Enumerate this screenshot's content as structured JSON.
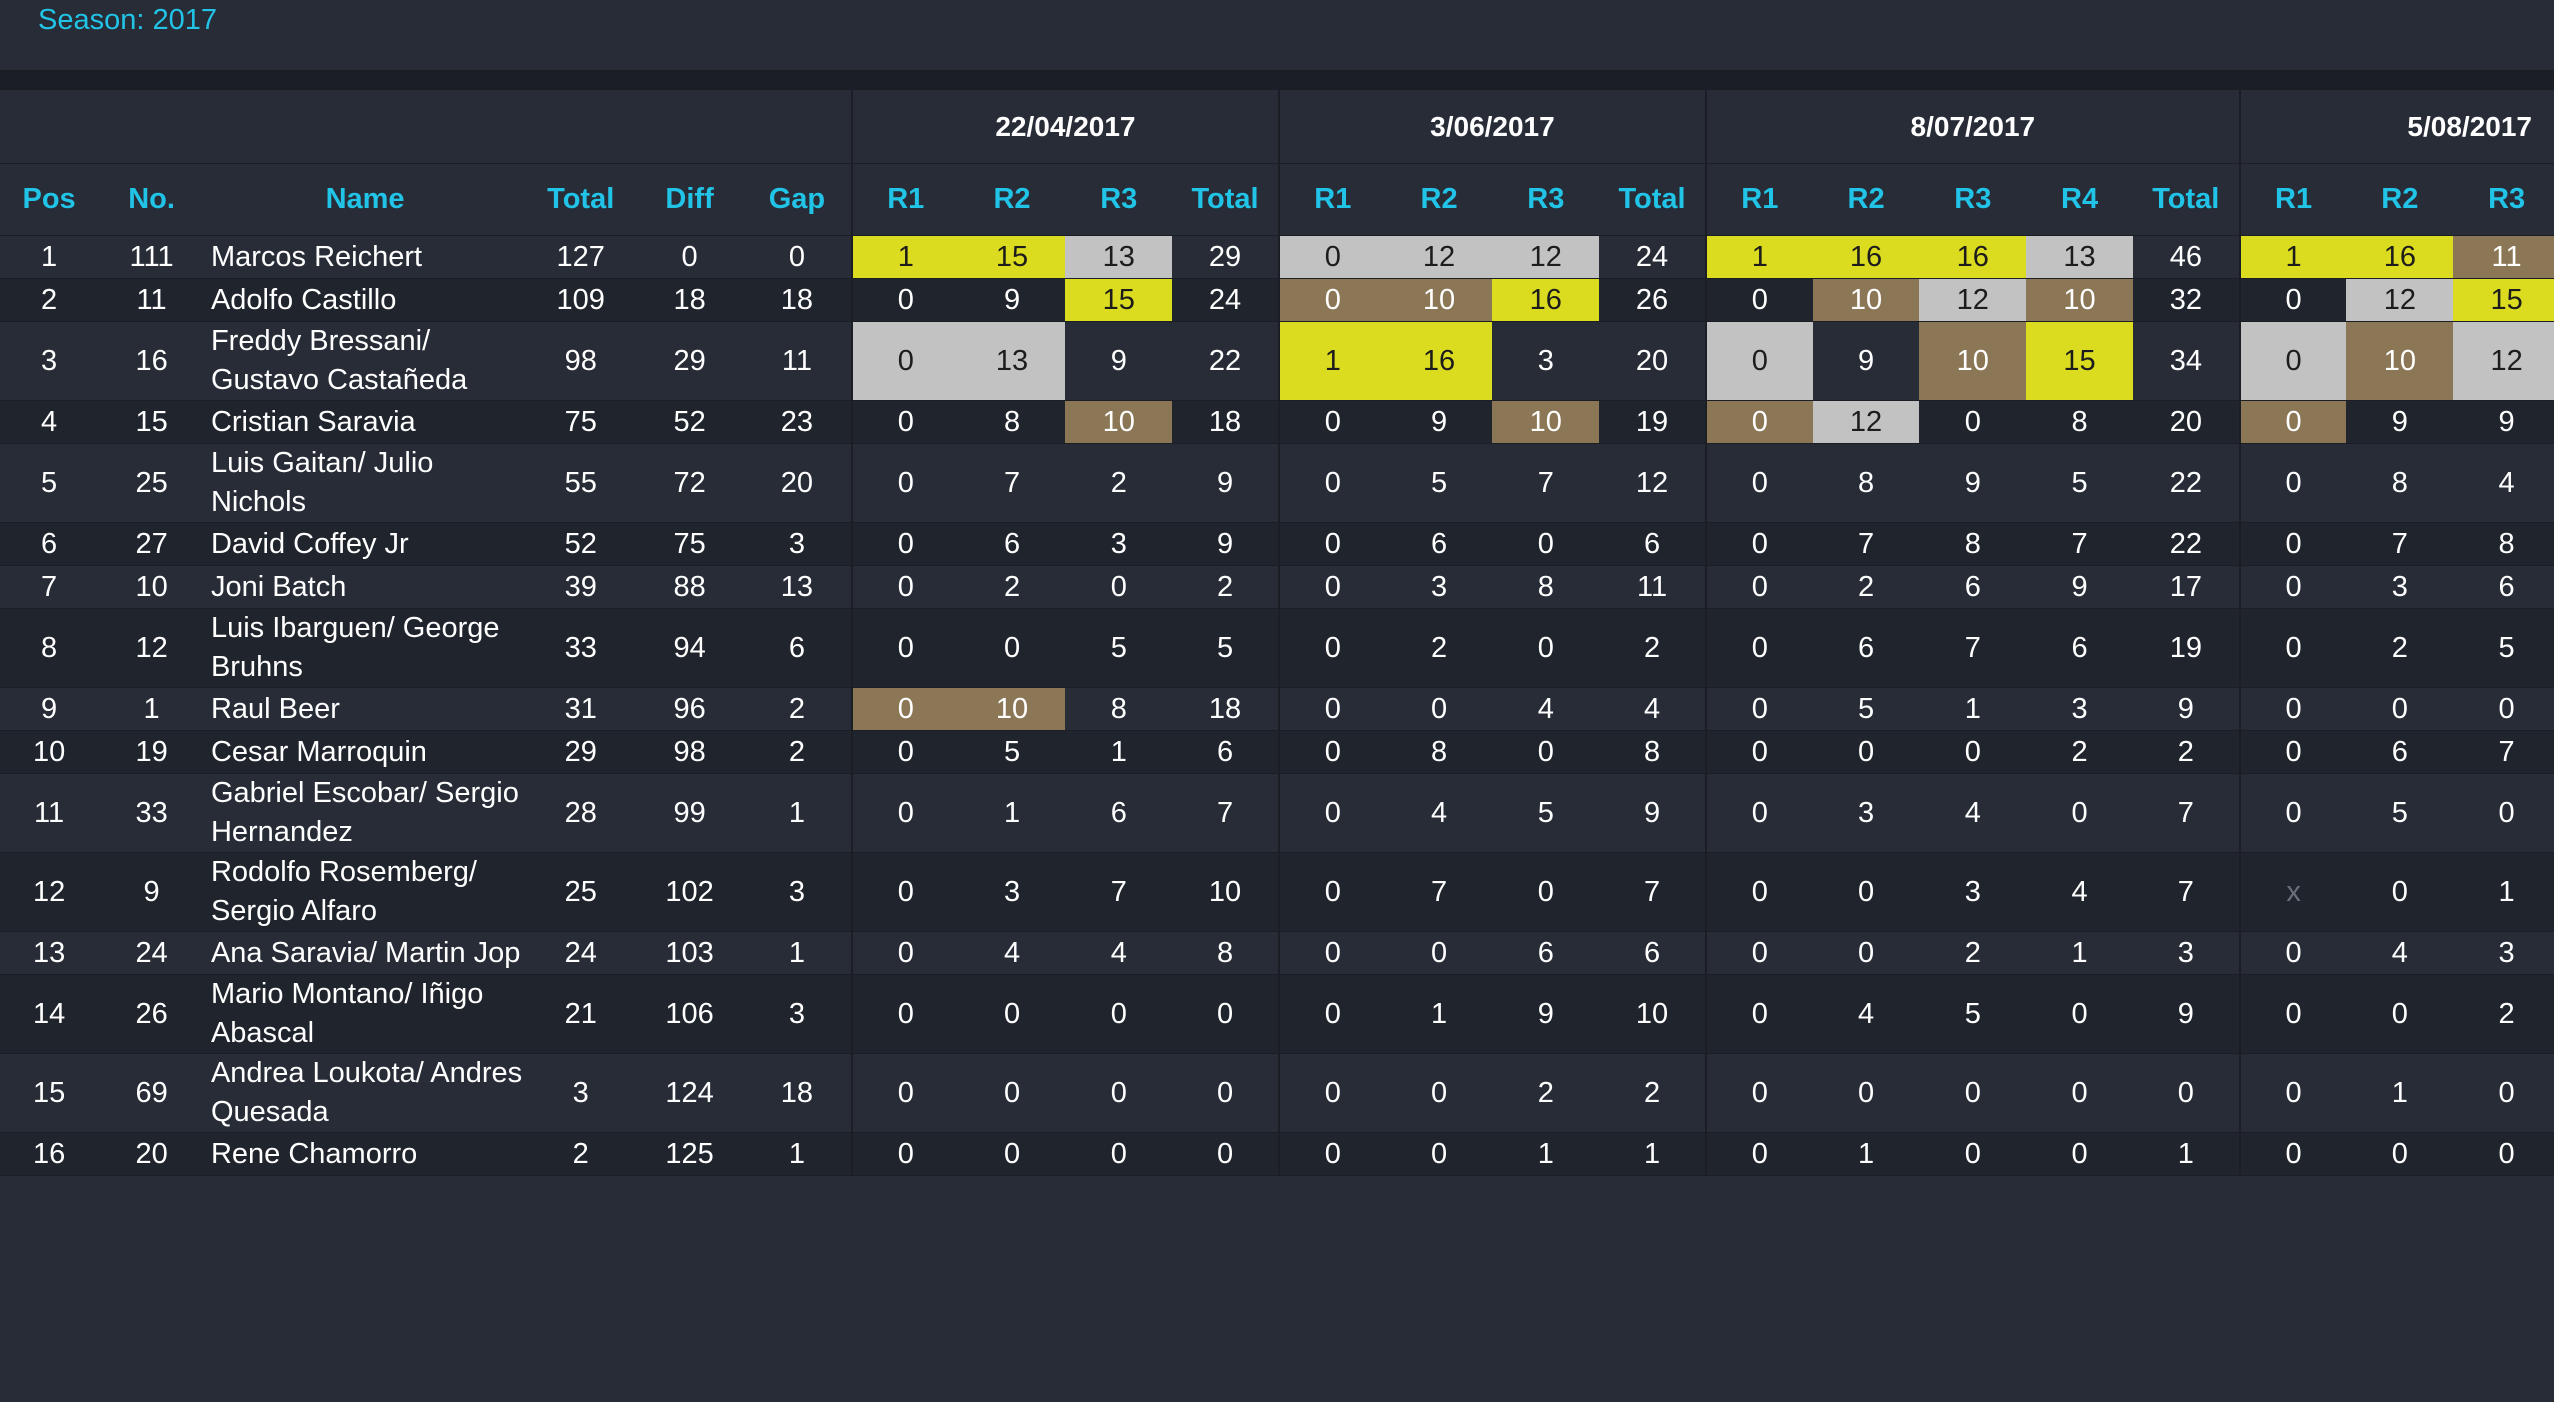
{
  "season_label": "Season: 2017",
  "events": [
    {
      "date": "22/04/2017",
      "races": [
        "R1",
        "R2",
        "R3"
      ]
    },
    {
      "date": "3/06/2017",
      "races": [
        "R1",
        "R2",
        "R3"
      ]
    },
    {
      "date": "8/07/2017",
      "races": [
        "R1",
        "R2",
        "R3",
        "R4"
      ]
    },
    {
      "date": "5/08/2017",
      "races": [
        "R1",
        "R2",
        "R3"
      ]
    }
  ],
  "headers": {
    "pos": "Pos",
    "no": "No.",
    "name": "Name",
    "total": "Total",
    "diff": "Diff",
    "gap": "Gap",
    "event_total": "Total"
  },
  "colors": {
    "gold": "#dbdb1f",
    "silver": "#c2c2c2",
    "bronze": "#8b7655",
    "accent": "#21c4e6"
  },
  "rows": [
    {
      "pos": "1",
      "no": "111",
      "name": "Marcos Reichert",
      "total": "127",
      "diff": "0",
      "gap": "0",
      "events": [
        {
          "r": [
            "1",
            "15",
            "13"
          ],
          "m": [
            "g",
            "g",
            "s"
          ],
          "t": "29"
        },
        {
          "r": [
            "0",
            "12",
            "12"
          ],
          "m": [
            "s",
            "s",
            "s"
          ],
          "t": "24"
        },
        {
          "r": [
            "1",
            "16",
            "16",
            "13"
          ],
          "m": [
            "g",
            "g",
            "g",
            "s"
          ],
          "t": "46"
        },
        {
          "r": [
            "1",
            "16",
            "11"
          ],
          "m": [
            "g",
            "g",
            "b"
          ]
        }
      ]
    },
    {
      "pos": "2",
      "no": "11",
      "name": "Adolfo Castillo",
      "total": "109",
      "diff": "18",
      "gap": "18",
      "events": [
        {
          "r": [
            "0",
            "9",
            "15"
          ],
          "m": [
            "",
            "",
            "g"
          ],
          "t": "24"
        },
        {
          "r": [
            "0",
            "10",
            "16"
          ],
          "m": [
            "b",
            "b",
            "g"
          ],
          "t": "26"
        },
        {
          "r": [
            "0",
            "10",
            "12",
            "10"
          ],
          "m": [
            "",
            "b",
            "s",
            "b"
          ],
          "t": "32"
        },
        {
          "r": [
            "0",
            "12",
            "15"
          ],
          "m": [
            "",
            "s",
            "g"
          ]
        }
      ]
    },
    {
      "pos": "3",
      "no": "16",
      "name": "Freddy Bressani/ Gustavo Castañeda",
      "total": "98",
      "diff": "29",
      "gap": "11",
      "events": [
        {
          "r": [
            "0",
            "13",
            "9"
          ],
          "m": [
            "s",
            "s",
            ""
          ],
          "t": "22"
        },
        {
          "r": [
            "1",
            "16",
            "3"
          ],
          "m": [
            "g",
            "g",
            ""
          ],
          "t": "20"
        },
        {
          "r": [
            "0",
            "9",
            "10",
            "15"
          ],
          "m": [
            "s",
            "",
            "b",
            "g"
          ],
          "t": "34"
        },
        {
          "r": [
            "0",
            "10",
            "12"
          ],
          "m": [
            "s",
            "b",
            "s"
          ]
        }
      ]
    },
    {
      "pos": "4",
      "no": "15",
      "name": "Cristian Saravia",
      "total": "75",
      "diff": "52",
      "gap": "23",
      "events": [
        {
          "r": [
            "0",
            "8",
            "10"
          ],
          "m": [
            "",
            "",
            "b"
          ],
          "t": "18"
        },
        {
          "r": [
            "0",
            "9",
            "10"
          ],
          "m": [
            "",
            "",
            "b"
          ],
          "t": "19"
        },
        {
          "r": [
            "0",
            "12",
            "0",
            "8"
          ],
          "m": [
            "b",
            "s",
            "",
            ""
          ],
          "t": "20"
        },
        {
          "r": [
            "0",
            "9",
            "9"
          ],
          "m": [
            "b",
            "",
            ""
          ]
        }
      ]
    },
    {
      "pos": "5",
      "no": "25",
      "name": "Luis Gaitan/ Julio Nichols",
      "total": "55",
      "diff": "72",
      "gap": "20",
      "events": [
        {
          "r": [
            "0",
            "7",
            "2"
          ],
          "m": [
            "",
            "",
            ""
          ],
          "t": "9"
        },
        {
          "r": [
            "0",
            "5",
            "7"
          ],
          "m": [
            "",
            "",
            ""
          ],
          "t": "12"
        },
        {
          "r": [
            "0",
            "8",
            "9",
            "5"
          ],
          "m": [
            "",
            "",
            "",
            ""
          ],
          "t": "22"
        },
        {
          "r": [
            "0",
            "8",
            "4"
          ],
          "m": [
            "",
            "",
            ""
          ]
        }
      ]
    },
    {
      "pos": "6",
      "no": "27",
      "name": "David Coffey Jr",
      "total": "52",
      "diff": "75",
      "gap": "3",
      "events": [
        {
          "r": [
            "0",
            "6",
            "3"
          ],
          "m": [
            "",
            "",
            ""
          ],
          "t": "9"
        },
        {
          "r": [
            "0",
            "6",
            "0"
          ],
          "m": [
            "",
            "",
            ""
          ],
          "t": "6"
        },
        {
          "r": [
            "0",
            "7",
            "8",
            "7"
          ],
          "m": [
            "",
            "",
            "",
            ""
          ],
          "t": "22"
        },
        {
          "r": [
            "0",
            "7",
            "8"
          ],
          "m": [
            "",
            "",
            ""
          ]
        }
      ]
    },
    {
      "pos": "7",
      "no": "10",
      "name": "Joni Batch",
      "total": "39",
      "diff": "88",
      "gap": "13",
      "events": [
        {
          "r": [
            "0",
            "2",
            "0"
          ],
          "m": [
            "",
            "",
            ""
          ],
          "t": "2"
        },
        {
          "r": [
            "0",
            "3",
            "8"
          ],
          "m": [
            "",
            "",
            ""
          ],
          "t": "11"
        },
        {
          "r": [
            "0",
            "2",
            "6",
            "9"
          ],
          "m": [
            "",
            "",
            "",
            ""
          ],
          "t": "17"
        },
        {
          "r": [
            "0",
            "3",
            "6"
          ],
          "m": [
            "",
            "",
            ""
          ]
        }
      ]
    },
    {
      "pos": "8",
      "no": "12",
      "name": "Luis Ibarguen/ George Bruhns",
      "total": "33",
      "diff": "94",
      "gap": "6",
      "events": [
        {
          "r": [
            "0",
            "0",
            "5"
          ],
          "m": [
            "",
            "",
            ""
          ],
          "t": "5"
        },
        {
          "r": [
            "0",
            "2",
            "0"
          ],
          "m": [
            "",
            "",
            ""
          ],
          "t": "2"
        },
        {
          "r": [
            "0",
            "6",
            "7",
            "6"
          ],
          "m": [
            "",
            "",
            "",
            ""
          ],
          "t": "19"
        },
        {
          "r": [
            "0",
            "2",
            "5"
          ],
          "m": [
            "",
            "",
            ""
          ]
        }
      ]
    },
    {
      "pos": "9",
      "no": "1",
      "name": "Raul Beer",
      "total": "31",
      "diff": "96",
      "gap": "2",
      "events": [
        {
          "r": [
            "0",
            "10",
            "8"
          ],
          "m": [
            "b",
            "b",
            ""
          ],
          "t": "18"
        },
        {
          "r": [
            "0",
            "0",
            "4"
          ],
          "m": [
            "",
            "",
            ""
          ],
          "t": "4"
        },
        {
          "r": [
            "0",
            "5",
            "1",
            "3"
          ],
          "m": [
            "",
            "",
            "",
            ""
          ],
          "t": "9"
        },
        {
          "r": [
            "0",
            "0",
            "0"
          ],
          "m": [
            "",
            "",
            ""
          ]
        }
      ]
    },
    {
      "pos": "10",
      "no": "19",
      "name": "Cesar Marroquin",
      "total": "29",
      "diff": "98",
      "gap": "2",
      "events": [
        {
          "r": [
            "0",
            "5",
            "1"
          ],
          "m": [
            "",
            "",
            ""
          ],
          "t": "6"
        },
        {
          "r": [
            "0",
            "8",
            "0"
          ],
          "m": [
            "",
            "",
            ""
          ],
          "t": "8"
        },
        {
          "r": [
            "0",
            "0",
            "0",
            "2"
          ],
          "m": [
            "",
            "",
            "",
            ""
          ],
          "t": "2"
        },
        {
          "r": [
            "0",
            "6",
            "7"
          ],
          "m": [
            "",
            "",
            ""
          ]
        }
      ]
    },
    {
      "pos": "11",
      "no": "33",
      "name": "Gabriel Escobar/ Sergio Hernandez",
      "total": "28",
      "diff": "99",
      "gap": "1",
      "events": [
        {
          "r": [
            "0",
            "1",
            "6"
          ],
          "m": [
            "",
            "",
            ""
          ],
          "t": "7"
        },
        {
          "r": [
            "0",
            "4",
            "5"
          ],
          "m": [
            "",
            "",
            ""
          ],
          "t": "9"
        },
        {
          "r": [
            "0",
            "3",
            "4",
            "0"
          ],
          "m": [
            "",
            "",
            "",
            ""
          ],
          "t": "7"
        },
        {
          "r": [
            "0",
            "5",
            "0"
          ],
          "m": [
            "",
            "",
            ""
          ]
        }
      ]
    },
    {
      "pos": "12",
      "no": "9",
      "name": "Rodolfo Rosemberg/ Sergio Alfaro",
      "total": "25",
      "diff": "102",
      "gap": "3",
      "events": [
        {
          "r": [
            "0",
            "3",
            "7"
          ],
          "m": [
            "",
            "",
            ""
          ],
          "t": "10"
        },
        {
          "r": [
            "0",
            "7",
            "0"
          ],
          "m": [
            "",
            "",
            ""
          ],
          "t": "7"
        },
        {
          "r": [
            "0",
            "0",
            "3",
            "4"
          ],
          "m": [
            "",
            "",
            "",
            ""
          ],
          "t": "7"
        },
        {
          "r": [
            "x",
            "0",
            "1"
          ],
          "m": [
            "x",
            "",
            ""
          ]
        }
      ]
    },
    {
      "pos": "13",
      "no": "24",
      "name": "Ana Saravia/ Martin Jop",
      "total": "24",
      "diff": "103",
      "gap": "1",
      "events": [
        {
          "r": [
            "0",
            "4",
            "4"
          ],
          "m": [
            "",
            "",
            ""
          ],
          "t": "8"
        },
        {
          "r": [
            "0",
            "0",
            "6"
          ],
          "m": [
            "",
            "",
            ""
          ],
          "t": "6"
        },
        {
          "r": [
            "0",
            "0",
            "2",
            "1"
          ],
          "m": [
            "",
            "",
            "",
            ""
          ],
          "t": "3"
        },
        {
          "r": [
            "0",
            "4",
            "3"
          ],
          "m": [
            "",
            "",
            ""
          ]
        }
      ]
    },
    {
      "pos": "14",
      "no": "26",
      "name": "Mario Montano/ Iñigo Abascal",
      "total": "21",
      "diff": "106",
      "gap": "3",
      "events": [
        {
          "r": [
            "0",
            "0",
            "0"
          ],
          "m": [
            "",
            "",
            ""
          ],
          "t": "0"
        },
        {
          "r": [
            "0",
            "1",
            "9"
          ],
          "m": [
            "",
            "",
            ""
          ],
          "t": "10"
        },
        {
          "r": [
            "0",
            "4",
            "5",
            "0"
          ],
          "m": [
            "",
            "",
            "",
            ""
          ],
          "t": "9"
        },
        {
          "r": [
            "0",
            "0",
            "2"
          ],
          "m": [
            "",
            "",
            ""
          ]
        }
      ]
    },
    {
      "pos": "15",
      "no": "69",
      "name": "Andrea Loukota/ Andres Quesada",
      "total": "3",
      "diff": "124",
      "gap": "18",
      "events": [
        {
          "r": [
            "0",
            "0",
            "0"
          ],
          "m": [
            "",
            "",
            ""
          ],
          "t": "0"
        },
        {
          "r": [
            "0",
            "0",
            "2"
          ],
          "m": [
            "",
            "",
            ""
          ],
          "t": "2"
        },
        {
          "r": [
            "0",
            "0",
            "0",
            "0"
          ],
          "m": [
            "",
            "",
            "",
            ""
          ],
          "t": "0"
        },
        {
          "r": [
            "0",
            "1",
            "0"
          ],
          "m": [
            "",
            "",
            ""
          ]
        }
      ]
    },
    {
      "pos": "16",
      "no": "20",
      "name": "Rene Chamorro",
      "total": "2",
      "diff": "125",
      "gap": "1",
      "events": [
        {
          "r": [
            "0",
            "0",
            "0"
          ],
          "m": [
            "",
            "",
            ""
          ],
          "t": "0"
        },
        {
          "r": [
            "0",
            "0",
            "1"
          ],
          "m": [
            "",
            "",
            ""
          ],
          "t": "1"
        },
        {
          "r": [
            "0",
            "1",
            "0",
            "0"
          ],
          "m": [
            "",
            "",
            "",
            ""
          ],
          "t": "1"
        },
        {
          "r": [
            "0",
            "0",
            "0"
          ],
          "m": [
            "",
            "",
            ""
          ]
        }
      ]
    }
  ]
}
